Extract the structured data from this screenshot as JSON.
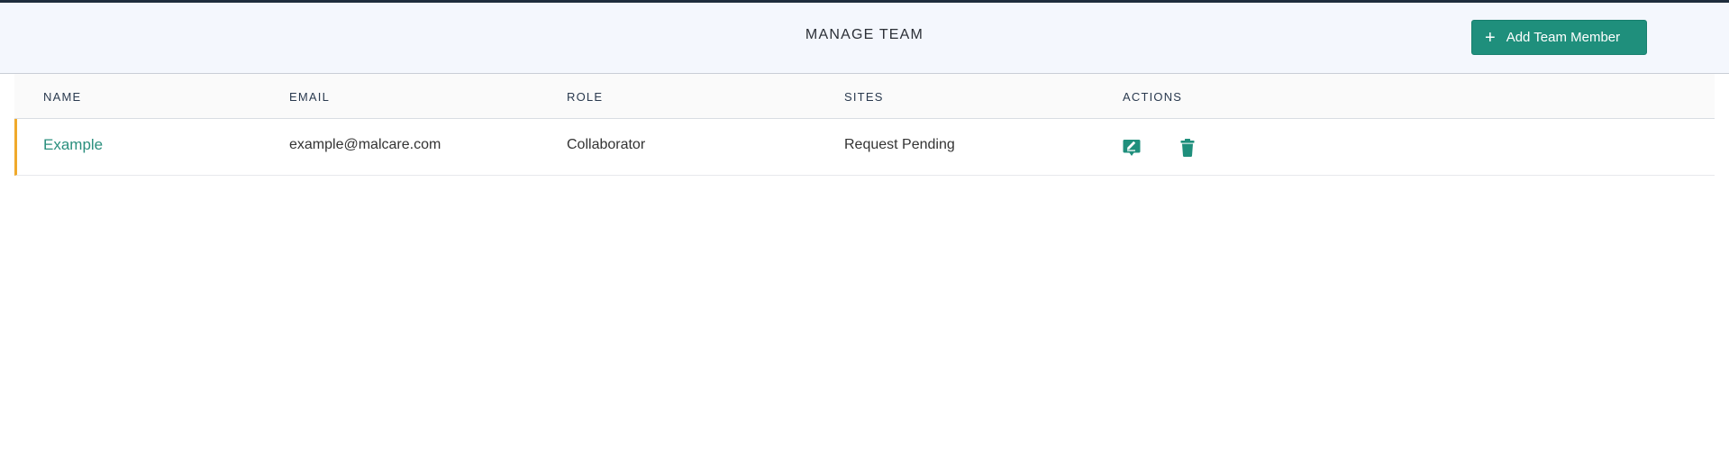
{
  "header": {
    "title": "MANAGE TEAM",
    "add_button_label": "Add Team Member",
    "add_button_icon": "plus-icon"
  },
  "table": {
    "columns": [
      "NAME",
      "EMAIL",
      "ROLE",
      "SITES",
      "ACTIONS"
    ],
    "rows": [
      {
        "name": "Example",
        "email": "example@malcare.com",
        "role": "Collaborator",
        "sites": "Request Pending",
        "actions": [
          "edit-icon",
          "trash-icon"
        ]
      }
    ]
  },
  "colors": {
    "accent": "#1f8f7c",
    "row_marker": "#f0a92b",
    "header_bg": "#f4f7fd"
  }
}
